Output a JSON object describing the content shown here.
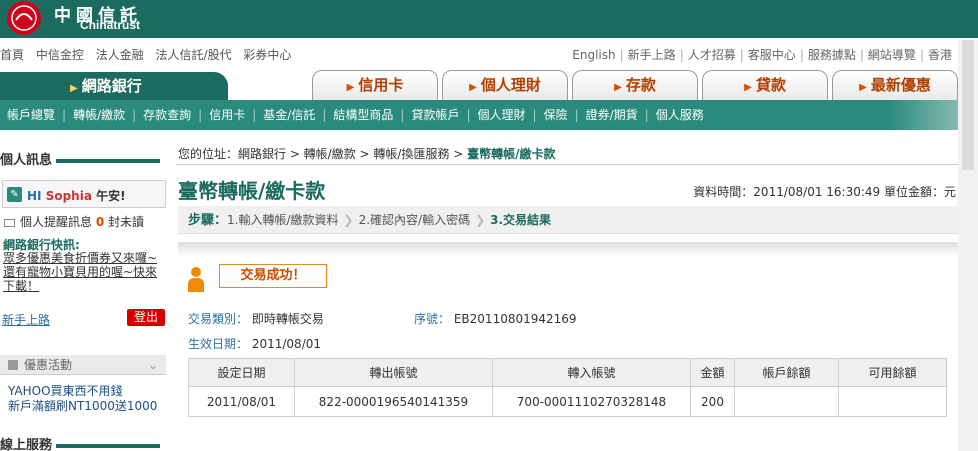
{
  "brand": {
    "name_zh": "中國信託",
    "name_en": "Chinatrust",
    "primary_color": "#1c6b60",
    "accent_color": "#e04a00"
  },
  "util_nav_left": [
    "首頁",
    "中信金控",
    "法人金融",
    "法人信託/股代",
    "彩券中心"
  ],
  "util_nav_right": [
    "English",
    "新手上路",
    "人才招募",
    "客服中心",
    "服務據點",
    "網站導覽",
    "香港"
  ],
  "main_tab": "網路銀行",
  "tabs": [
    "信用卡",
    "個人理財",
    "存款",
    "貸款",
    "最新優惠"
  ],
  "subnav": [
    "帳戶總覽",
    "轉帳/繳款",
    "存款查詢",
    "信用卡",
    "基金/信託",
    "結構型商品",
    "貸款帳戶",
    "個人理財",
    "保險",
    "證券/期貨",
    "個人服務"
  ],
  "sidebar": {
    "personal_title": "個人訊息",
    "greeting_prefix": "HI",
    "user_name": "Sophia",
    "greeting_suffix": "午安!",
    "msg_label": "個人提醒訊息",
    "msg_count": "0",
    "msg_unit": "封未讀",
    "news_title": "網路銀行快訊:",
    "news_body": "眾多優惠美食折價券又來囉~還有寵物小寶貝用的喔~快來下載！",
    "newbie_link": "新手上路",
    "logout": "登出",
    "promo_title": "優惠活動",
    "promo_lines": [
      "YAHOO買東西不用錢",
      "新戶滿額刷NT1000送1000"
    ],
    "online_service_title": "線上服務"
  },
  "content": {
    "breadcrumb_prefix": "您的位址：網路銀行 > 轉帳/繳款 > 轉帳/換匯服務 >",
    "breadcrumb_current": "臺幣轉帳/繳卡款",
    "page_title": "臺幣轉帳/繳卡款",
    "data_time": "資料時間：2011/08/01 16:30:49 單位金額：元",
    "steps_label": "步驟：",
    "step1": "1.輸入轉帳/繳款資料",
    "step2": "2.確認內容/輸入密碼",
    "step3": "3.交易結果",
    "success_text": "交易成功！",
    "type_label": "交易類別：",
    "type_value": "即時轉帳交易",
    "serial_label": "序號：",
    "serial_value": "EB20110801942169",
    "eff_label": "生效日期：",
    "eff_value": "2011/08/01"
  },
  "table": {
    "headers": [
      "設定日期",
      "轉出帳號",
      "轉入帳號",
      "金額",
      "帳戶餘額",
      "可用餘額"
    ],
    "row": [
      "2011/08/01",
      "822-0000196540141359",
      "700-0001110270328148",
      "200",
      "",
      ""
    ]
  }
}
